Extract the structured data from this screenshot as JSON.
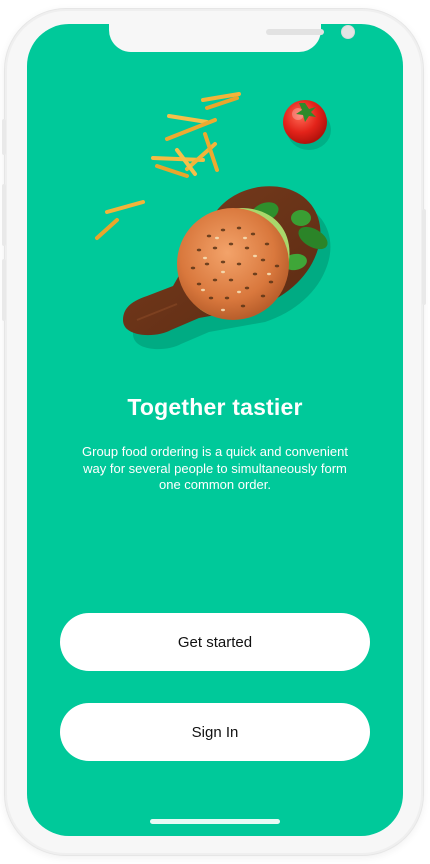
{
  "onboarding": {
    "title": "Together tastier",
    "description": "Group food ordering is a quick and convenient way for several people to simultaneously form one common order.",
    "illustration": "burger-on-board-with-fries-and-tomato"
  },
  "actions": {
    "get_started_label": "Get started",
    "sign_in_label": "Sign In"
  },
  "theme": {
    "accent": "#00C99A",
    "button_bg": "#FFFFFF",
    "button_text": "#111111"
  }
}
